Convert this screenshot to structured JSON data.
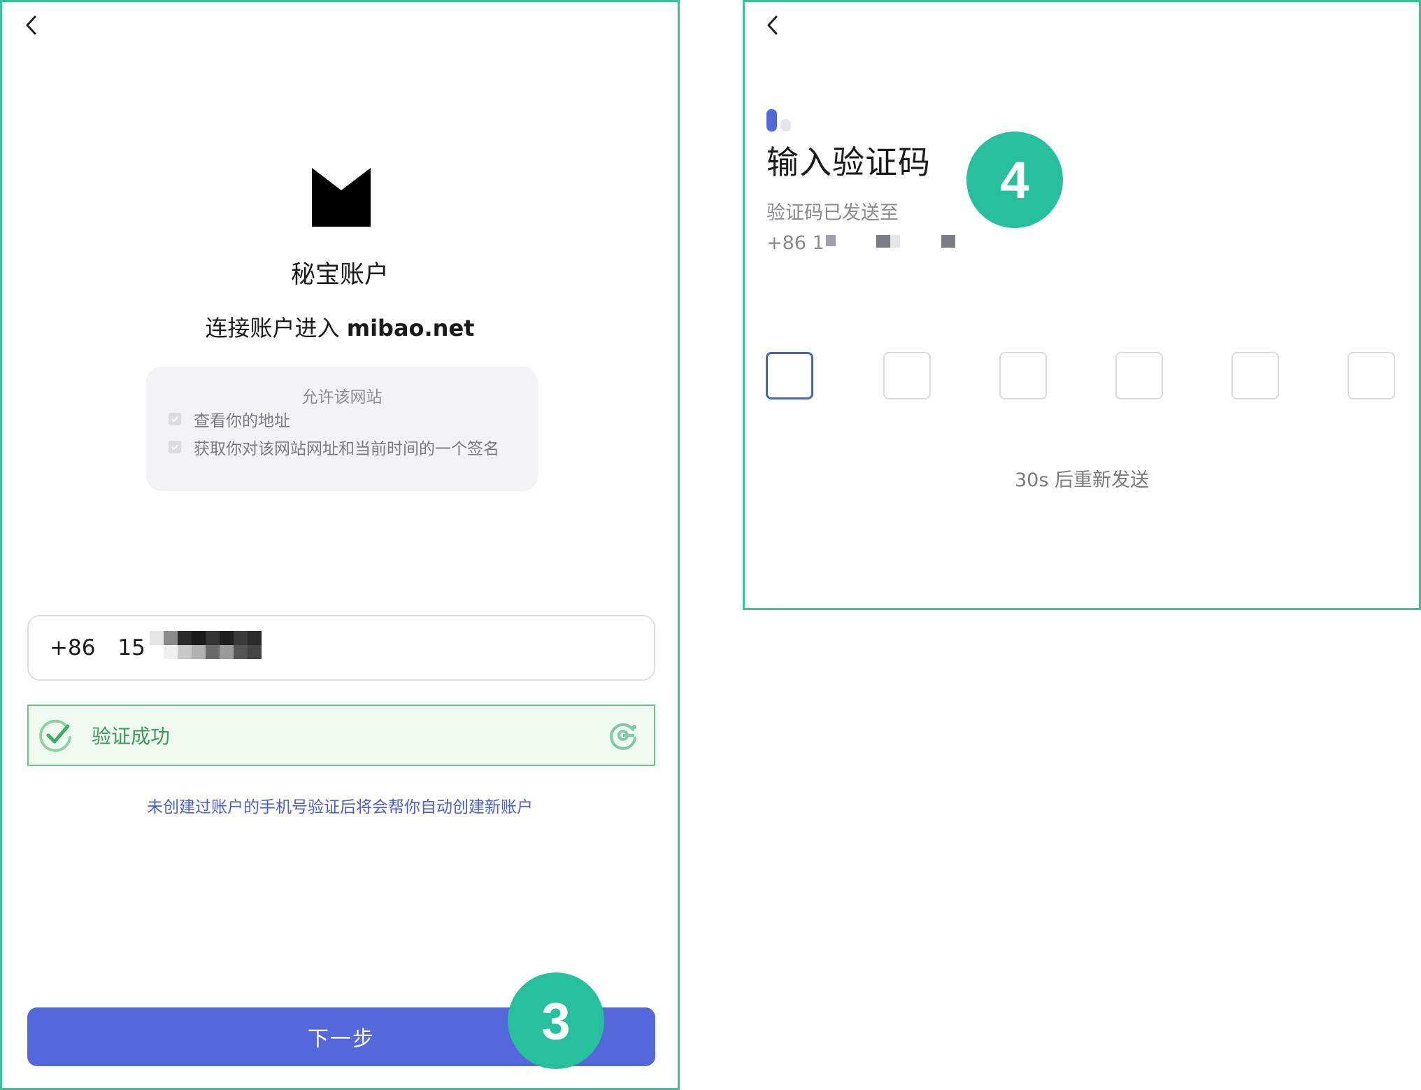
{
  "left": {
    "title": "秘宝账户",
    "subtitle_prefix": "连接账户进入 ",
    "subtitle_site": "mibao.net",
    "permission": {
      "title": "允许该网站",
      "items": [
        "查看你的地址",
        "获取你对该网站网址和当前时间的一个签名"
      ]
    },
    "phone": {
      "country_code": "+86",
      "number_visible": "15"
    },
    "verify": {
      "status": "验证成功"
    },
    "hint": "未创建过账户的手机号验证后将会帮你自动创建新账户",
    "next_button": "下一步",
    "step_badge": "3"
  },
  "right": {
    "title": "输入验证码",
    "sent_to": "验证码已发送至",
    "phone_prefix": "+86 1",
    "code_boxes": [
      "",
      "",
      "",
      "",
      "",
      ""
    ],
    "resend": "30s 后重新发送",
    "step_badge": "4"
  },
  "colors": {
    "panel_border": "#3fbf9a",
    "badge": "#27bf9c",
    "primary_button": "#5468dc",
    "success": "#3f9a5a",
    "hint": "#4d5ec9"
  },
  "icons": {
    "back": "chevron-left-icon",
    "logo": "mibao-m-logo",
    "checkbox": "check-icon",
    "success": "success-check-icon",
    "captcha_brand": "captcha-logo-icon"
  }
}
